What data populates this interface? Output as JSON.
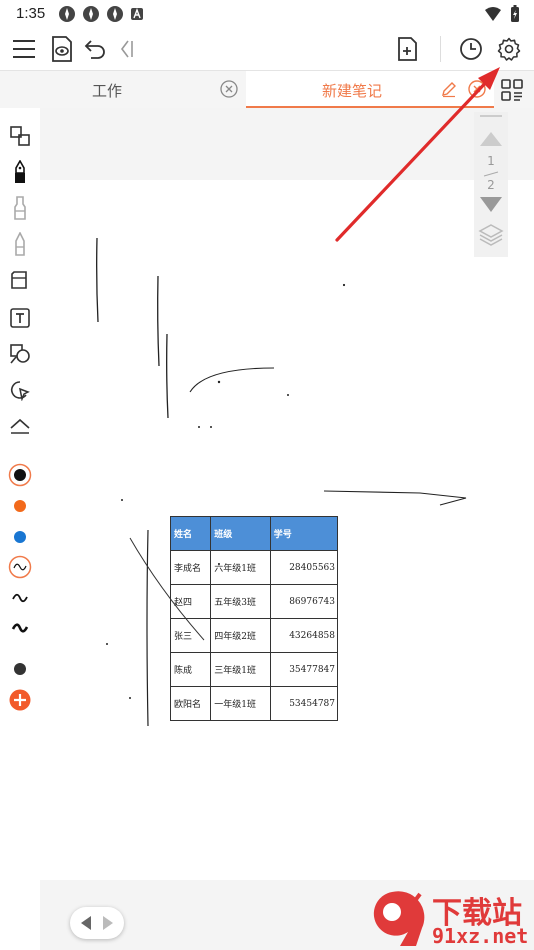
{
  "status_bar": {
    "time": "1:35"
  },
  "tabs": {
    "work_label": "工作",
    "active_label": "新建笔记"
  },
  "page_nav": {
    "current": "1",
    "total": "2"
  },
  "table": {
    "headers": [
      "姓名",
      "班级",
      "学号"
    ],
    "rows": [
      [
        "李成名",
        "六年级1班",
        "28405563"
      ],
      [
        "赵四",
        "五年级3班",
        "86976743"
      ],
      [
        "张三",
        "四年级2班",
        "43264858"
      ],
      [
        "陈成",
        "三年级1班",
        "35477847"
      ],
      [
        "欧阳名",
        "一年级1班",
        "53454787"
      ]
    ]
  },
  "watermark": {
    "line1": "下载站",
    "line2": "91xz.net"
  },
  "colors": {
    "accent": "#f07a4a",
    "arrow": "#e02b2b",
    "table_header": "#4d8fd7",
    "pen_black": "#111111",
    "pen_orange": "#f26a1b",
    "pen_blue": "#1976d2",
    "add": "#f25a2a"
  }
}
